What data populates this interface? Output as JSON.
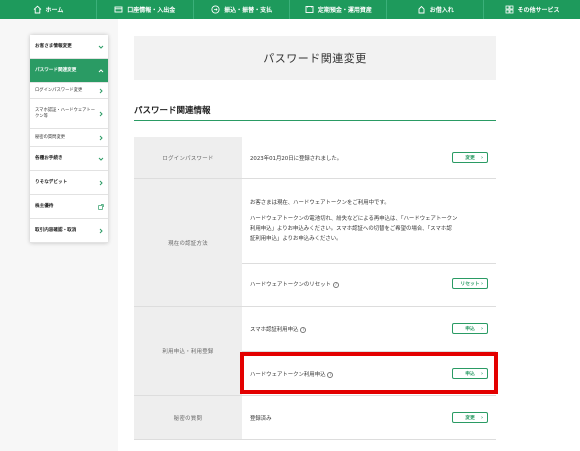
{
  "topnav": [
    {
      "label": "ホーム",
      "icon": "home-icon"
    },
    {
      "label": "口座情報・入出金",
      "icon": "account-icon"
    },
    {
      "label": "振込・振替・支払",
      "icon": "transfer-icon"
    },
    {
      "label": "定期預金・運用資産",
      "icon": "deposit-icon"
    },
    {
      "label": "お借入れ",
      "icon": "loan-icon"
    },
    {
      "label": "その他サービス",
      "icon": "services-icon"
    }
  ],
  "sidebar": {
    "items": [
      {
        "label": "お客さま情報変更"
      },
      {
        "label": "パスワード関連変更"
      },
      {
        "label": "ログインパスワード変更"
      },
      {
        "label": "スマホ認証・ハードウェアトークン等"
      },
      {
        "label": "秘密の質問変更"
      },
      {
        "label": "各種お手続き"
      },
      {
        "label": "りそなデビット"
      },
      {
        "label": "株主優待"
      },
      {
        "label": "取引内容確認・取消"
      }
    ]
  },
  "page": {
    "title": "パスワード関連変更",
    "section_title": "パスワード関連情報"
  },
  "table": {
    "login_password": {
      "header": "ログインパスワード",
      "text": "2023年01月20日に登録されました。",
      "button": "変更"
    },
    "auth_method": {
      "header": "現在の認証方法",
      "line1": "お客さまは現在、ハードウェアトークンをご利用中です。",
      "line2a": "ハードウェアトークンの電池切れ、紛失などによる再申込は、「ハードウェアトークン",
      "line2b": "利用申込」よりお申込みください。スマホ認証への切替をご希望の場合、「スマホ認",
      "line2c": "証利用申込」よりお申込みください。",
      "reset_text": "ハードウェアトークンのリセット",
      "reset_button": "リセット"
    },
    "usage": {
      "header": "利用申込・利用登録",
      "smartphone_text": "スマホ認証利用申込",
      "smartphone_button": "申込",
      "hardware_text": "ハードウェアトークン利用申込",
      "hardware_button": "申込"
    },
    "secret_question": {
      "header": "秘密の質問",
      "text": "登録済み",
      "button": "変更"
    }
  },
  "colors": {
    "brand_green": "#1e9a5c",
    "highlight_red": "#e30000"
  }
}
